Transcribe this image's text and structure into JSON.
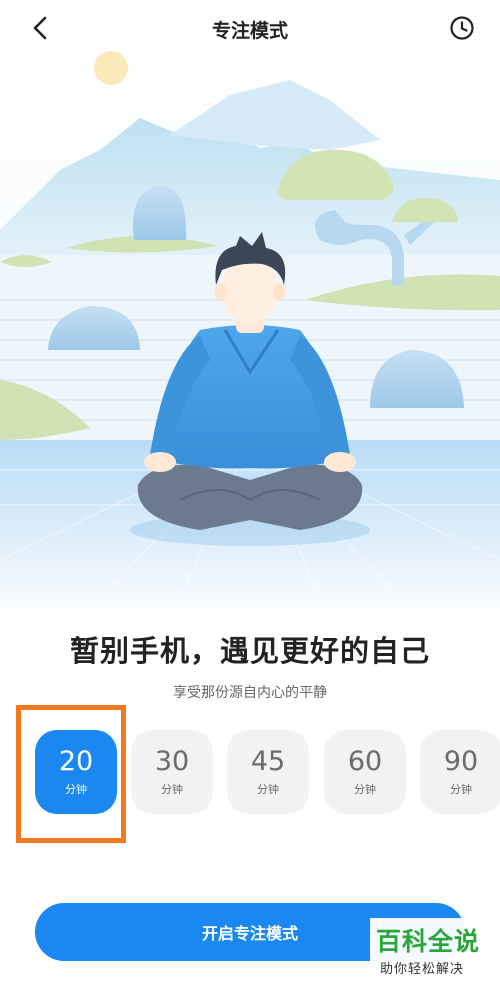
{
  "header": {
    "title": "专注模式",
    "back_icon": "chevron-left-icon",
    "history_icon": "clock-icon"
  },
  "hero": {
    "headline": "暂别手机，遇见更好的自己",
    "subtitle": "享受那份源自内心的平静"
  },
  "durations": [
    {
      "value": "20",
      "unit": "分钟",
      "selected": true
    },
    {
      "value": "30",
      "unit": "分钟",
      "selected": false
    },
    {
      "value": "45",
      "unit": "分钟",
      "selected": false
    },
    {
      "value": "60",
      "unit": "分钟",
      "selected": false
    },
    {
      "value": "90",
      "unit": "分钟",
      "selected": false
    }
  ],
  "start_button": {
    "label": "开启专注模式"
  },
  "watermark": {
    "title": "百科全说",
    "subtitle": "助你轻松解决"
  },
  "colors": {
    "accent": "#1a88f0",
    "highlight": "#f37a23",
    "tile_bg": "#f1f2f4"
  }
}
